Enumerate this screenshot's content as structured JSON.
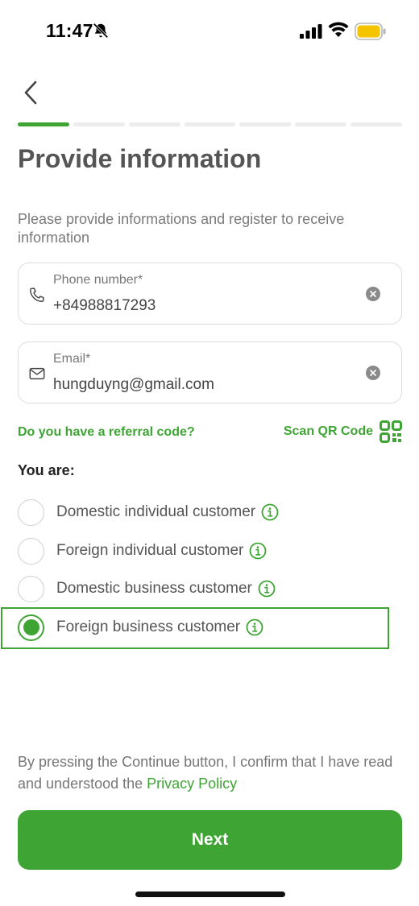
{
  "status_bar": {
    "time": "11:47",
    "icons": [
      "bell-off-icon",
      "signal-icon",
      "wifi-icon",
      "battery-icon"
    ],
    "battery_color": "#f5c400"
  },
  "header": {
    "back_icon": "chevron-left-icon",
    "progress": {
      "total_steps": 7,
      "current_step": 1
    }
  },
  "title": "Provide information",
  "subtitle": "Please provide informations and register to receive information",
  "fields": {
    "phone": {
      "label": "Phone number*",
      "value": "+84988817293",
      "icon": "phone-icon"
    },
    "email": {
      "label": "Email*",
      "value": "hungduyng@gmail.com",
      "icon": "mail-icon"
    }
  },
  "referral_link": "Do you have a referral code?",
  "scan_qr": {
    "label": "Scan QR Code",
    "icon": "qr-code-icon"
  },
  "you_are_label": "You are:",
  "options": [
    {
      "label": "Domestic individual customer",
      "selected": false
    },
    {
      "label": "Foreign individual customer",
      "selected": false
    },
    {
      "label": "Domestic business customer",
      "selected": false
    },
    {
      "label": "Foreign business customer",
      "selected": true
    }
  ],
  "consent": {
    "text": "By pressing the Continue button, I confirm that I have read and understood the ",
    "link": "Privacy Policy"
  },
  "next_button": "Next",
  "colors": {
    "accent": "#3ea534",
    "text_muted": "#777777",
    "border": "#dcdcdc"
  }
}
